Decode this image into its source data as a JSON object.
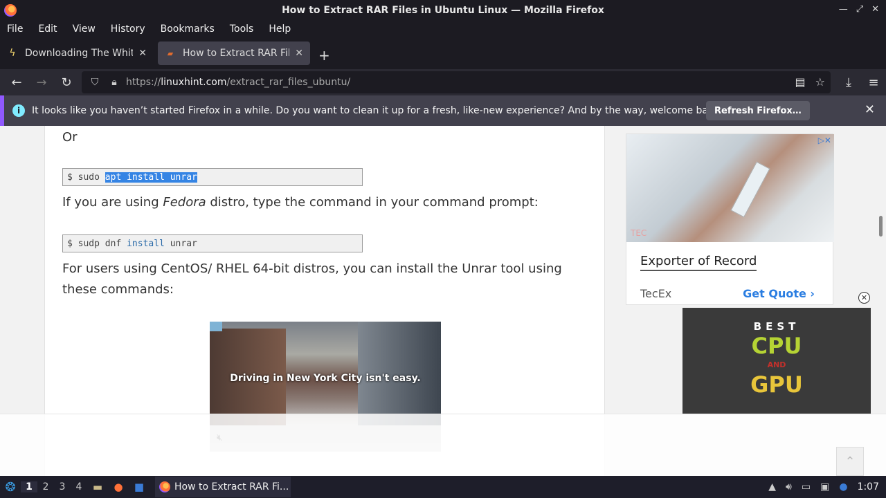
{
  "window": {
    "title": "How to Extract RAR Files in Ubuntu Linux — Mozilla Firefox"
  },
  "menu": [
    "File",
    "Edit",
    "View",
    "History",
    "Bookmarks",
    "Tools",
    "Help"
  ],
  "tabs": [
    {
      "label": "Downloading The White I",
      "icon": "lightning-icon",
      "close": "✕"
    },
    {
      "label": "How to Extract RAR Files",
      "icon": "linuxhint-favicon",
      "close": "✕"
    }
  ],
  "newtab": "+",
  "url": {
    "prefix": "https://",
    "domain": "linuxhint.com",
    "path": "/extract_rar_files_ubuntu/"
  },
  "notification": {
    "message": "It looks like you haven’t started Firefox in a while. Do you want to clean it up for a fresh, like-new experience? And by the way, welcome back!",
    "button": "Refresh Firefox…"
  },
  "article": {
    "or": "Or",
    "code1": {
      "prompt": "$ sudo ",
      "selected": "apt install unrar"
    },
    "fedora_pre": "If you are using ",
    "fedora_em": "Fedora",
    "fedora_post": " distro, type the command in your command prompt:",
    "code2": {
      "prompt": "$ sudp dnf ",
      "kw": "install",
      "rest": " unrar"
    },
    "centos": "For users using CentOS/ RHEL 64-bit distros, you can install the Unrar tool using these commands:",
    "video_caption": "Driving in New York City isn't easy."
  },
  "sidebar_ad": {
    "headline": "Exporter of Record",
    "brand": "TecEx",
    "cta": "Get Quote ›",
    "tag": "TEC"
  },
  "gpu_ad": {
    "best": "BEST",
    "cpu": "CPU",
    "and": "AND",
    "gpu": "GPU"
  },
  "taskbar": {
    "workspaces": [
      "1",
      "2",
      "3",
      "4"
    ],
    "task": "How to Extract RAR Fi...",
    "clock": "1:07"
  }
}
